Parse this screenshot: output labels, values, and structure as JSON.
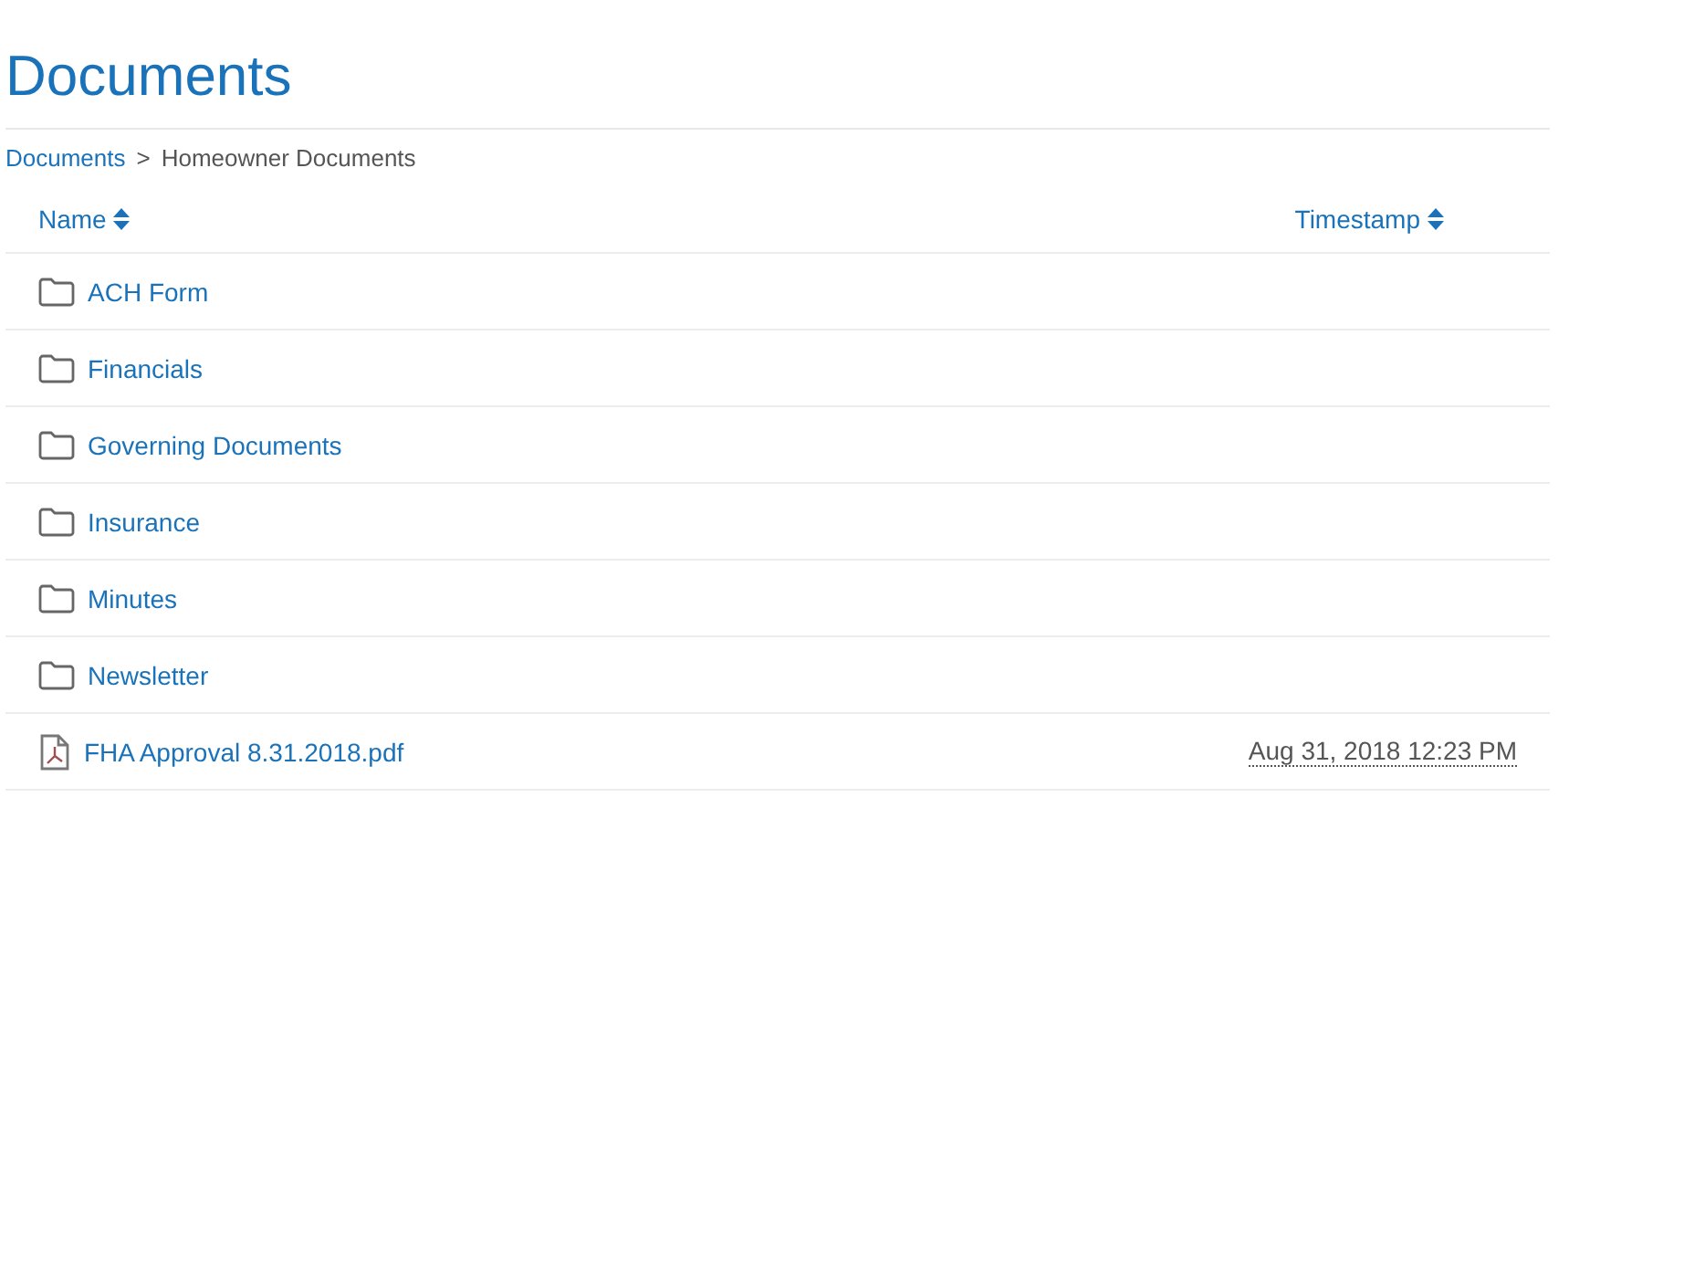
{
  "title": "Documents",
  "breadcrumb": [
    {
      "label": "Documents",
      "kind": "link"
    },
    {
      "label": ">",
      "kind": "separator"
    },
    {
      "label": "Homeowner Documents",
      "kind": "current"
    }
  ],
  "table": {
    "columns": [
      {
        "label": "Name",
        "sort_icon": true
      },
      {
        "label": "Timestamp",
        "sort_icon": true
      }
    ],
    "rows": [
      {
        "kind": "folder",
        "name": "ACH Form"
      },
      {
        "kind": "folder",
        "name": "Financials"
      },
      {
        "kind": "folder",
        "name": "Governing Documents"
      },
      {
        "kind": "folder",
        "name": "Insurance"
      },
      {
        "kind": "folder",
        "name": "Minutes"
      },
      {
        "kind": "folder",
        "name": "Newsletter"
      },
      {
        "kind": "pdf",
        "name": "FHA Approval 8.31.2018.pdf",
        "timestamp": "Aug 31, 2018 12:23 PM"
      }
    ]
  }
}
